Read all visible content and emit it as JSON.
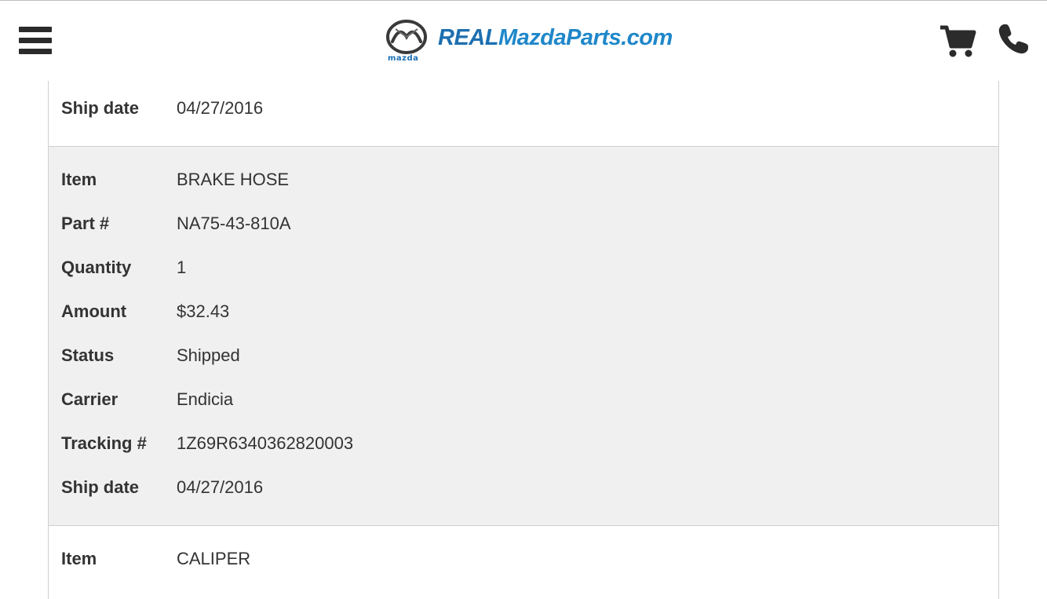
{
  "header": {
    "logo_brand_small": "mazda",
    "site_name_prefix": "REAL",
    "site_name_rest": "MazdaParts.com",
    "icons": {
      "menu": "hamburger-menu-icon",
      "cart": "shopping-cart-icon",
      "phone": "phone-icon"
    }
  },
  "colors": {
    "brand_blue": "#1f87c9",
    "panel_grey": "#f0f0f0",
    "text": "#333333"
  },
  "order_items": [
    {
      "rows": [
        {
          "label": "Ship date",
          "value": "04/27/2016"
        }
      ]
    },
    {
      "rows": [
        {
          "label": "Item",
          "value": "BRAKE HOSE"
        },
        {
          "label": "Part #",
          "value": "NA75-43-810A"
        },
        {
          "label": "Quantity",
          "value": "1"
        },
        {
          "label": "Amount",
          "value": "$32.43"
        },
        {
          "label": "Status",
          "value": "Shipped"
        },
        {
          "label": "Carrier",
          "value": "Endicia"
        },
        {
          "label": "Tracking #",
          "value": "1Z69R6340362820003"
        },
        {
          "label": "Ship date",
          "value": "04/27/2016"
        }
      ]
    },
    {
      "rows": [
        {
          "label": "Item",
          "value": "CALIPER"
        }
      ]
    }
  ]
}
